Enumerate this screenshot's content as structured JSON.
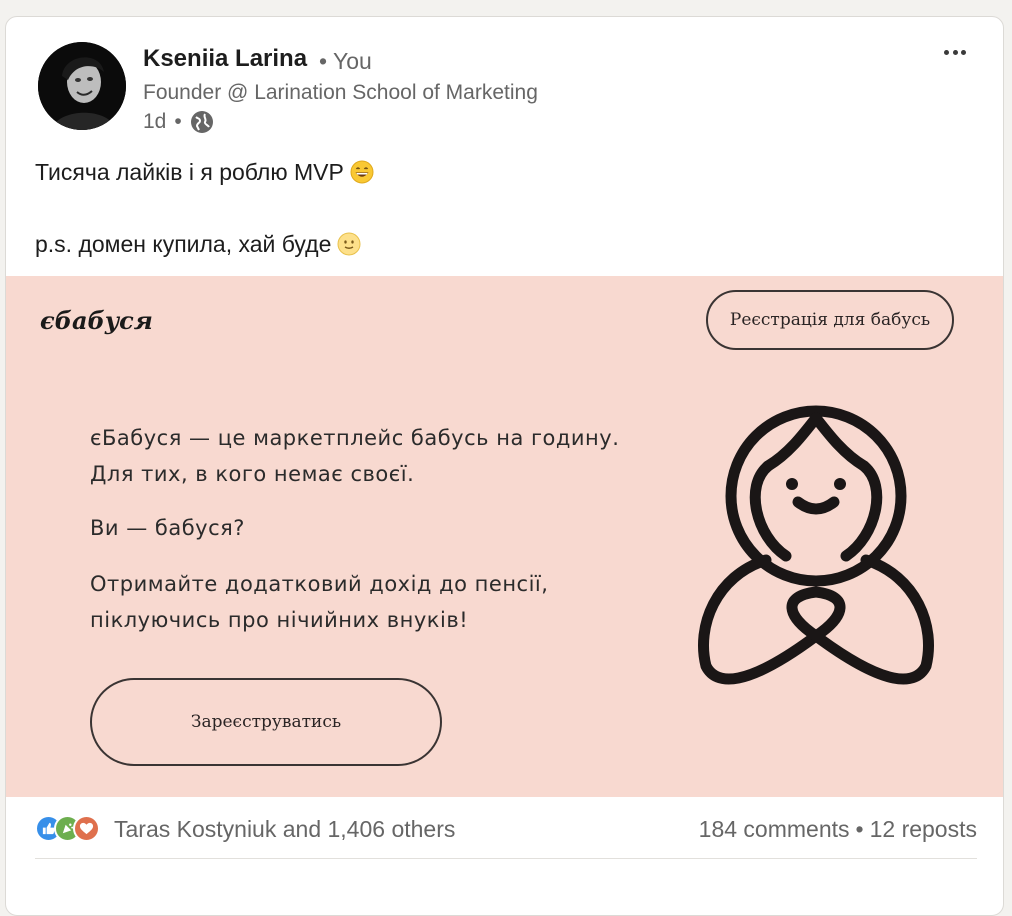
{
  "author": {
    "name": "Kseniia Larina",
    "degree": "• You",
    "headline": "Founder @ Larination School of Marketing",
    "time": "1d",
    "visibility_icon": "globe-icon"
  },
  "post": {
    "line1": "Тисяча лайків і я роблю MVP",
    "line1_emoji": "grinning-face-emoji",
    "line2": "p.s. домен купила, хай буде",
    "line2_emoji": "slightly-smiling-face-emoji"
  },
  "promo": {
    "logo": "єбабуся",
    "top_button": "Реєстрація для бабусь",
    "p1_line1": "єБабуся — це маркетплейс бабусь на годину.",
    "p1_line2": "Для тих, в кого немає своєї.",
    "p2": "Ви — бабуся?",
    "p3_line1": "Отримайте додатковий дохід до пенсії,",
    "p3_line2": "піклуючись про нічийних внуків!",
    "cta_button": "Зареєструватись",
    "background": "#f8d9d0"
  },
  "social": {
    "reaction_icons": [
      "like-icon",
      "celebrate-icon",
      "love-icon"
    ],
    "reactions_text": "Taras Kostyniuk and 1,406 others",
    "comments": "184 comments",
    "separator": "•",
    "reposts": "12 reposts"
  }
}
